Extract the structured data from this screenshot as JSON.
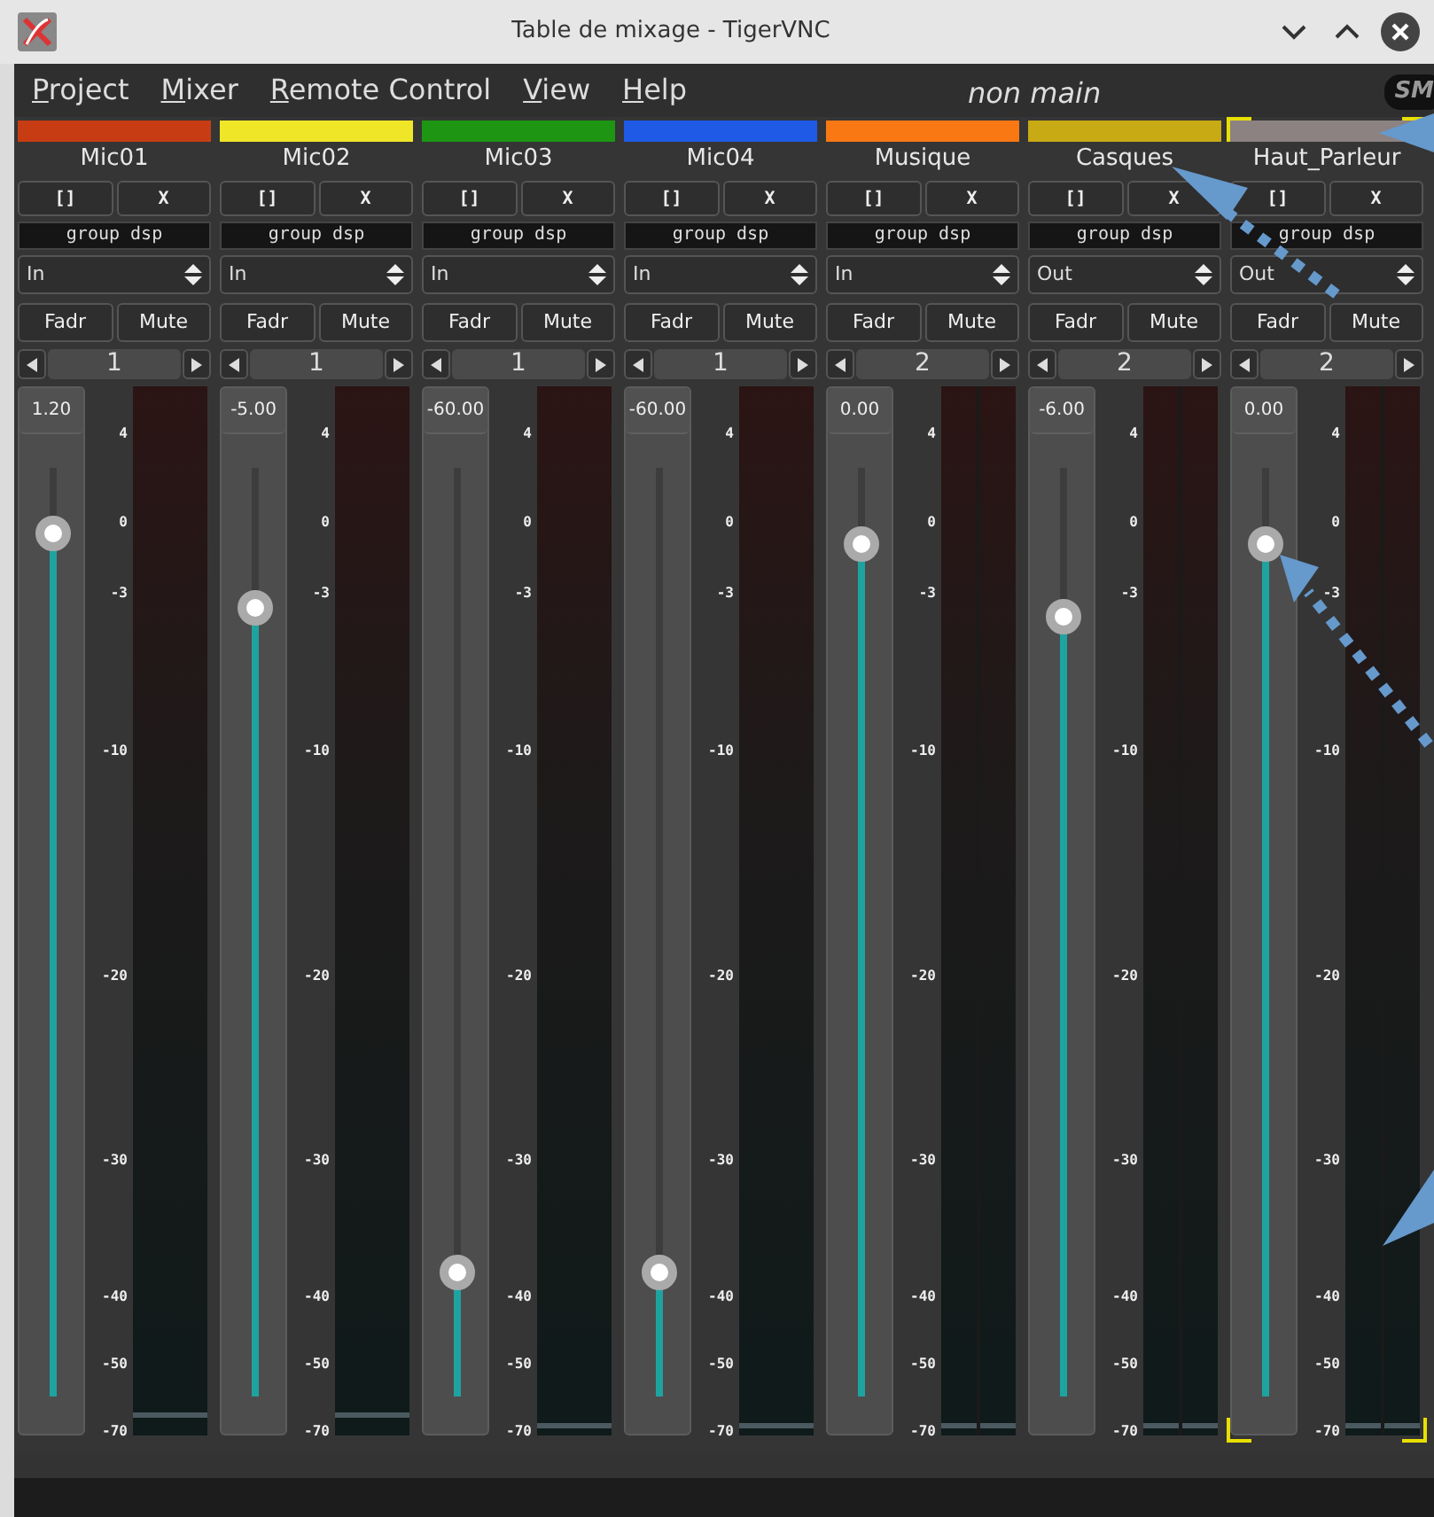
{
  "window": {
    "title": "Table de mixage - TigerVNC"
  },
  "menu": {
    "items": [
      "Project",
      "Mixer",
      "Remote Control",
      "View",
      "Help"
    ],
    "context": "non main",
    "logo": "SM"
  },
  "strips": [
    {
      "name": "Mic01",
      "color": "#c83c14",
      "selected": false,
      "buttons": [
        "[]",
        "X"
      ],
      "group": "group dsp",
      "mode": "In",
      "actions": [
        "Fadr",
        "Mute"
      ],
      "page": "1",
      "gain": "1.20",
      "level": 0.93,
      "kind": "mono",
      "scale": [
        "4",
        "0",
        "-3",
        "-10",
        "-20",
        "-30",
        "-40",
        "-50",
        "-70"
      ]
    },
    {
      "name": "Mic02",
      "color": "#f0e628",
      "selected": false,
      "buttons": [
        "[]",
        "X"
      ],
      "group": "group dsp",
      "mode": "In",
      "actions": [
        "Fadr",
        "Mute"
      ],
      "page": "1",
      "gain": "-5.00",
      "level": 0.85,
      "kind": "mono",
      "scale": [
        "4",
        "0",
        "-3",
        "-10",
        "-20",
        "-30",
        "-40",
        "-50",
        "-70"
      ]
    },
    {
      "name": "Mic03",
      "color": "#1e9614",
      "selected": false,
      "buttons": [
        "[]",
        "X"
      ],
      "group": "group dsp",
      "mode": "In",
      "actions": [
        "Fadr",
        "Mute"
      ],
      "page": "1",
      "gain": "-60.00",
      "level": 0.134,
      "kind": "mono",
      "scale": [
        "4",
        "0",
        "-3",
        "-10",
        "-20",
        "-30",
        "-40",
        "-50",
        "-70"
      ]
    },
    {
      "name": "Mic04",
      "color": "#1e5ae6",
      "selected": false,
      "buttons": [
        "[]",
        "X"
      ],
      "group": "group dsp",
      "mode": "In",
      "actions": [
        "Fadr",
        "Mute"
      ],
      "page": "1",
      "gain": "-60.00",
      "level": 0.134,
      "kind": "mono",
      "scale": [
        "4",
        "0",
        "-3",
        "-10",
        "-20",
        "-30",
        "-40",
        "-50",
        "-70"
      ]
    },
    {
      "name": "Musique",
      "color": "#fa7814",
      "selected": false,
      "buttons": [
        "[]",
        "X"
      ],
      "group": "group dsp",
      "mode": "In",
      "actions": [
        "Fadr",
        "Mute"
      ],
      "page": "2",
      "gain": "0.00",
      "level": 0.918,
      "kind": "stereo",
      "scale": [
        "4",
        "0",
        "-3",
        "-10",
        "-20",
        "-30",
        "-40",
        "-50",
        "-70"
      ]
    },
    {
      "name": "Casques",
      "color": "#c8aa14",
      "selected": false,
      "buttons": [
        "[]",
        "X"
      ],
      "group": "group dsp",
      "mode": "Out",
      "actions": [
        "Fadr",
        "Mute"
      ],
      "page": "2",
      "gain": "-6.00",
      "level": 0.84,
      "kind": "stereo",
      "scale": [
        "4",
        "0",
        "-3",
        "-10",
        "-20",
        "-30",
        "-40",
        "-50",
        "-70"
      ]
    },
    {
      "name": "Haut_Parleur",
      "color": "#8c8282",
      "selected": true,
      "buttons": [
        "[]",
        "X"
      ],
      "group": "group dsp",
      "mode": "Out",
      "actions": [
        "Fadr",
        "Mute"
      ],
      "page": "2",
      "gain": "0.00",
      "level": 0.918,
      "kind": "stereo",
      "scale": [
        "4",
        "0",
        "-3",
        "-10",
        "-20",
        "-30",
        "-40",
        "-50",
        "-70"
      ]
    }
  ]
}
